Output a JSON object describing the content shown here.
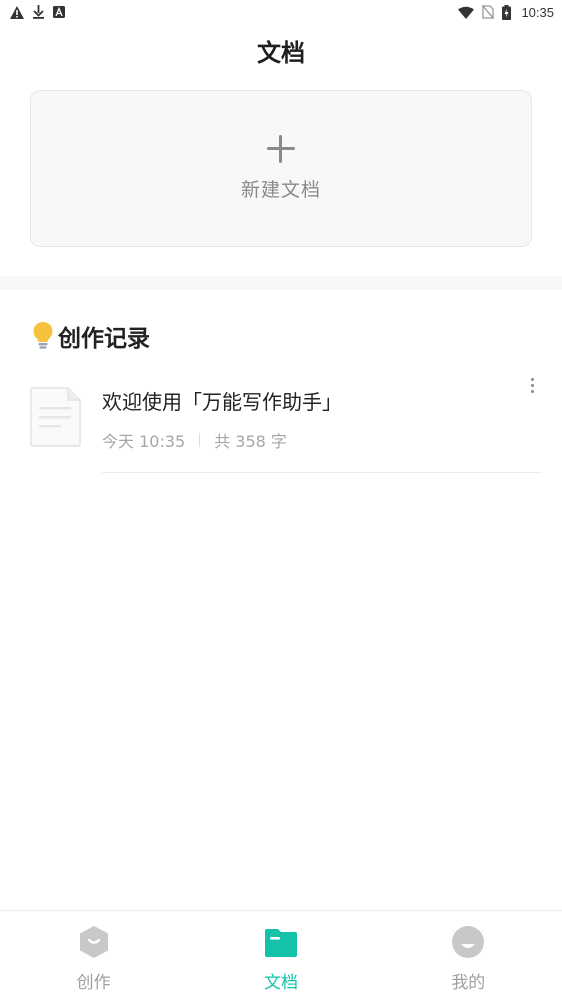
{
  "status_bar": {
    "time": "10:35",
    "left_icons": [
      "warning-icon",
      "download-icon",
      "a-icon"
    ],
    "right_icons": [
      "wifi-icon",
      "no-sim-icon",
      "battery-charging-icon"
    ]
  },
  "header": {
    "title": "文档"
  },
  "new_doc": {
    "label": "新建文档",
    "icon": "plus-icon"
  },
  "section": {
    "title": "创作记录",
    "icon": "lightbulb-icon"
  },
  "documents": [
    {
      "title": "欢迎使用「万能写作助手」",
      "time": "今天 10:35",
      "word_count": "共 358 字"
    }
  ],
  "bottom_nav": {
    "items": [
      {
        "label": "创作",
        "icon": "create-icon",
        "active": false
      },
      {
        "label": "文档",
        "icon": "folder-icon",
        "active": true
      },
      {
        "label": "我的",
        "icon": "profile-icon",
        "active": false
      }
    ]
  },
  "colors": {
    "accent": "#13c2a9",
    "inactive": "#a0a0a0",
    "bulb": "#f6c23e"
  }
}
